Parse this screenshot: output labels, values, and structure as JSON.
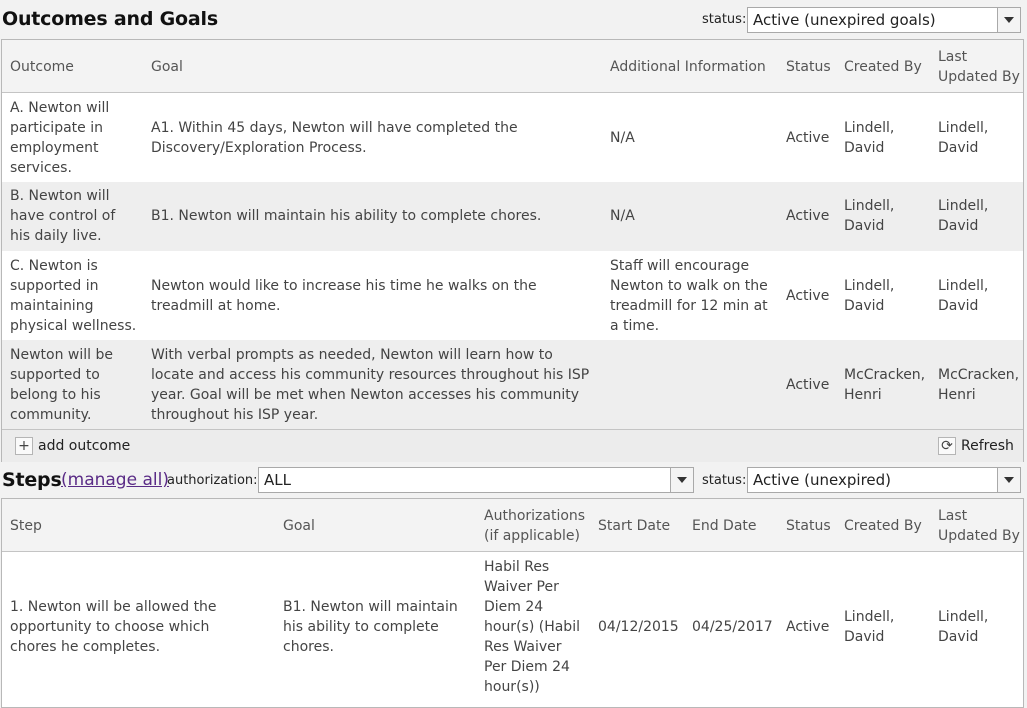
{
  "outcomes": {
    "title": "Outcomes and Goals",
    "status_label": "status:",
    "status_value": "Active (unexpired goals)",
    "columns": [
      "Outcome",
      "Goal",
      "Additional Information",
      "Status",
      "Created By",
      "Last Updated By"
    ],
    "rows": [
      {
        "outcome": "A. Newton will participate in employment services.",
        "goal": "A1. Within 45 days, Newton will have completed the Discovery/Exploration Process.",
        "info": "N/A",
        "status": "Active",
        "created": "Lindell, David",
        "updated": "Lindell, David"
      },
      {
        "outcome": "B. Newton will have control of his daily live.",
        "goal": "B1. Newton will maintain his ability to complete chores.",
        "info": "N/A",
        "status": "Active",
        "created": "Lindell, David",
        "updated": "Lindell, David"
      },
      {
        "outcome": "C. Newton is supported in maintaining physical wellness.",
        "goal": "Newton would like to increase his time he walks on the treadmill at home.",
        "info": "Staff will encourage Newton to walk on the treadmill for 12 min at a time.",
        "status": "Active",
        "created": "Lindell, David",
        "updated": "Lindell, David"
      },
      {
        "outcome": "Newton will be supported to belong to his community.",
        "goal": "With verbal prompts as needed, Newton will learn how to locate and access his community resources throughout his ISP year. Goal will be met when Newton accesses his community throughout his ISP year.",
        "info": "",
        "status": "Active",
        "created": "McCracken, Henri",
        "updated": "McCracken, Henri"
      }
    ],
    "add_label": "add outcome",
    "refresh_label": "Refresh"
  },
  "steps": {
    "title": "Steps",
    "manage_link": "(manage all)",
    "auth_label": "authorization:",
    "auth_value": "ALL",
    "status_label": "status:",
    "status_value": "Active (unexpired)",
    "columns": [
      "Step",
      "Goal",
      "Authorizations (if applicable)",
      "Start Date",
      "End Date",
      "Status",
      "Created By",
      "Last Updated By"
    ],
    "rows": [
      {
        "step": "1. Newton will be allowed the opportunity to choose which chores he completes.",
        "goal": "B1. Newton will maintain his ability to complete chores.",
        "auth": "Habil Res Waiver Per Diem 24 hour(s) (Habil Res Waiver Per Diem 24 hour(s))",
        "start": "04/12/2015",
        "end": "04/25/2017",
        "status": "Active",
        "created": "Lindell, David",
        "updated": "Lindell, David"
      }
    ]
  }
}
